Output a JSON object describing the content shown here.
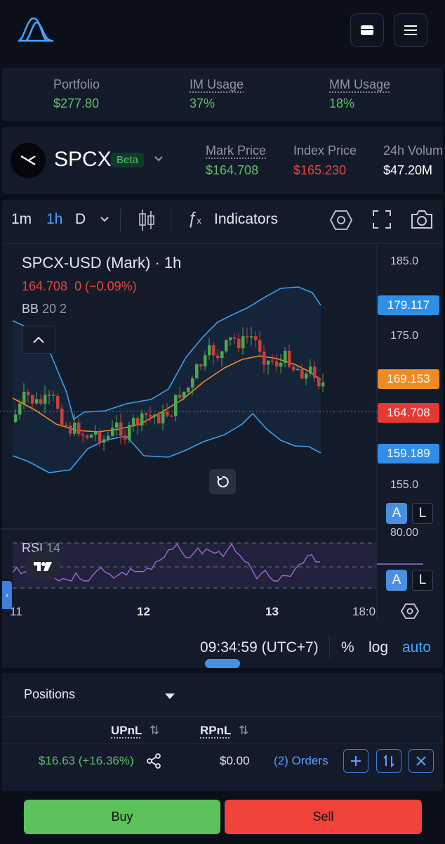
{
  "header": {
    "logo_icon": "exchange-logo-icon",
    "wallet_icon": "wallet-icon",
    "menu_icon": "hamburger-menu-icon"
  },
  "stats": {
    "portfolio_label": "Portfolio",
    "portfolio_value": "$277.80",
    "im_label": "IM Usage",
    "im_value": "37%",
    "mm_label": "MM Usage",
    "mm_value": "18%"
  },
  "market": {
    "symbol": "SPCX",
    "badge": "Beta",
    "mark_label": "Mark Price",
    "mark_value": "$164.708",
    "index_label": "Index Price",
    "index_value": "$165.230",
    "volume_label": "24h Volum",
    "volume_value": "$47.20M"
  },
  "toolbar": {
    "tf_1m": "1m",
    "tf_1h": "1h",
    "tf_d": "D",
    "indicators": "Indicators"
  },
  "chart": {
    "title": "SPCX-USD (Mark) · 1h",
    "ohlc_line": "164.708  0 (−0.09%)",
    "bb_label": "BB",
    "bb_params": "20 2",
    "rsi_label": "RSI",
    "rsi_params": "14",
    "axis_labels": {
      "p185": "185.0",
      "p175": "175.0",
      "p155": "155.0",
      "rsi80": "80.00"
    },
    "tags": {
      "upper": "179.117",
      "mid": "169.153",
      "last": "164.708",
      "lower": "159.189"
    },
    "btn_a": "A",
    "btn_l": "L",
    "x_labels": {
      "d11": "11",
      "d12": "12",
      "d13": "13",
      "t18": "18:0"
    },
    "time": "09:34:59 (UTC+7)",
    "pct": "%",
    "log": "log",
    "auto": "auto",
    "colors": {
      "up": "#4fa64f",
      "down": "#c9403a",
      "bb_band": "#3aa0f0",
      "bb_mid": "#f08a24",
      "rsi": "#9b6bd6"
    }
  },
  "positions": {
    "tab_label": "Positions",
    "upnl_label": "UPnL",
    "rpnl_label": "RPnL",
    "upnl_value": "$16.63 (+16.36%)",
    "rpnl_value": "$0.00",
    "orders_label": "(2) Orders"
  },
  "actions": {
    "buy": "Buy",
    "sell": "Sell"
  }
}
